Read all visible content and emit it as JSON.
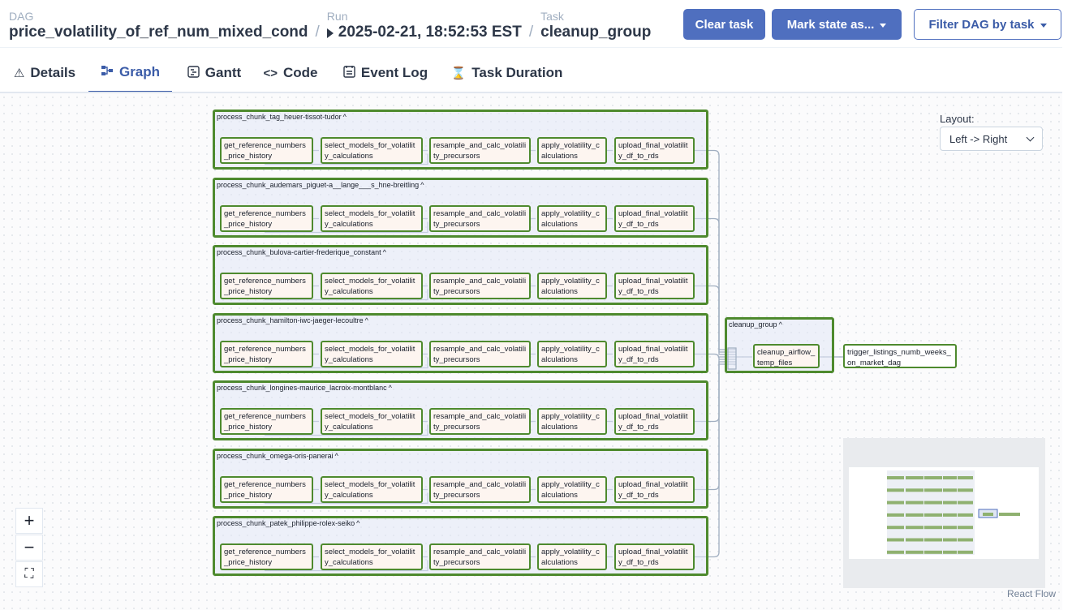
{
  "header": {
    "dag_label": "DAG",
    "dag_value": "price_volatility_of_ref_num_mixed_cond",
    "run_label": "Run",
    "run_value": "2025-02-21, 18:52:53 EST",
    "task_label": "Task",
    "task_value": "cleanup_group",
    "separator": "/"
  },
  "buttons": {
    "clear_task": "Clear task",
    "mark_state": "Mark state as...",
    "filter_dag": "Filter DAG by task"
  },
  "tabs": [
    {
      "label": "Details",
      "icon": "warning-triangle-icon"
    },
    {
      "label": "Graph",
      "icon": "graph-icon"
    },
    {
      "label": "Gantt",
      "icon": "gantt-icon"
    },
    {
      "label": "Code",
      "icon": "code-icon"
    },
    {
      "label": "Event Log",
      "icon": "event-log-icon"
    },
    {
      "label": "Task Duration",
      "icon": "hourglass-icon"
    }
  ],
  "graph": {
    "groups": [
      {
        "title": "process_chunk_tag_heuer-tissot-tudor"
      },
      {
        "title": "process_chunk_audemars_piguet-a__lange___s_hne-breitling"
      },
      {
        "title": "process_chunk_bulova-cartier-frederique_constant"
      },
      {
        "title": "process_chunk_hamilton-iwc-jaeger-lecoultre"
      },
      {
        "title": "process_chunk_longines-maurice_lacroix-montblanc"
      },
      {
        "title": "process_chunk_omega-oris-panerai"
      },
      {
        "title": "process_chunk_patek_philippe-rolex-seiko"
      }
    ],
    "chunk_tasks": [
      "get_reference_numbers_price_history",
      "select_models_for_volatility_calculations",
      "resample_and_calc_volatility_precursors",
      "apply_volatility_calculations",
      "upload_final_volatility_df_to_rds"
    ],
    "cleanup_group": {
      "title": "cleanup_group",
      "task": "cleanup_airflow_temp_files"
    },
    "final_task": "trigger_listings_numb_weeks_on_market_dag",
    "group_chevron": "^"
  },
  "layout": {
    "label": "Layout:",
    "value": "Left -> Right"
  },
  "zoom": {
    "zoom_in": "+",
    "zoom_out": "−",
    "fit_view": "⛶"
  },
  "attribution": "React Flow",
  "colors": {
    "accent": "#4f6fbf",
    "success_border": "#4e8a2e",
    "edge": "#a0aec0"
  }
}
